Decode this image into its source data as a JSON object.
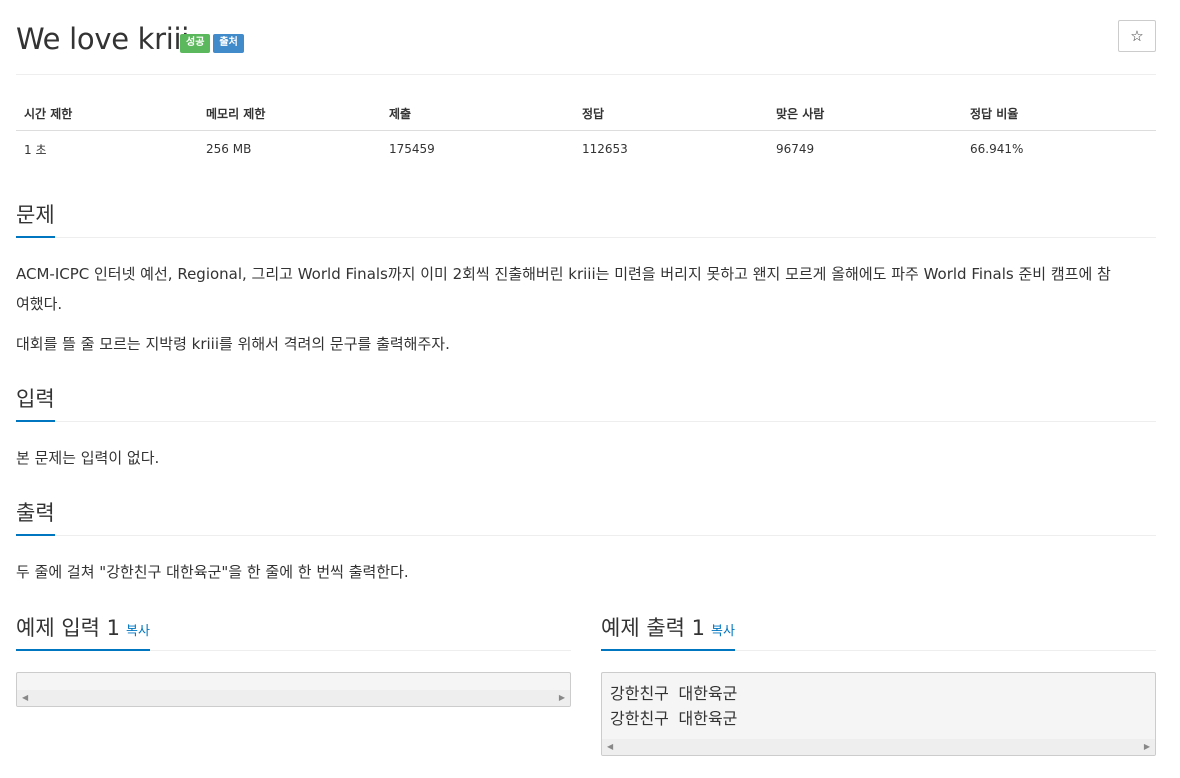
{
  "problem": {
    "title": "We love kriii",
    "badges": [
      "성공",
      "출처"
    ],
    "star_icon": "star-icon"
  },
  "info_table": {
    "headers": [
      "시간 제한",
      "메모리 제한",
      "제출",
      "정답",
      "맞은 사람",
      "정답 비율"
    ],
    "values": [
      "1 초",
      "256 MB",
      "175459",
      "112653",
      "96749",
      "66.941%"
    ]
  },
  "sections": {
    "description": {
      "heading": "문제",
      "p1": "ACM-ICPC 인터넷 예선, Regional, 그리고 World Finals까지 이미 2회씩 진출해버린 kriii는 미련을 버리지 못하고 왠지 모르게 올해에도 파주 World Finals 준비 캠프에 참",
      "p1b": "여했다.",
      "p2": "대회를 뜰 줄 모르는 지박령 kriii를 위해서 격려의 문구를 출력해주자."
    },
    "input": {
      "heading": "입력",
      "text": "본 문제는 입력이 없다."
    },
    "output": {
      "heading": "출력",
      "text": "두 줄에 걸쳐 \"강한친구 대한육군\"을 한 줄에 한 번씩 출력한다."
    },
    "sample_input": {
      "heading": "예제 입력 1",
      "copy": "복사",
      "content": ""
    },
    "sample_output": {
      "heading": "예제 출력 1",
      "copy": "복사",
      "content": "강한친구 대한육군\n강한친구 대한육군"
    }
  },
  "colors": {
    "success": "#5cb85c",
    "source": "#428bca",
    "accent": "#0076c0"
  }
}
